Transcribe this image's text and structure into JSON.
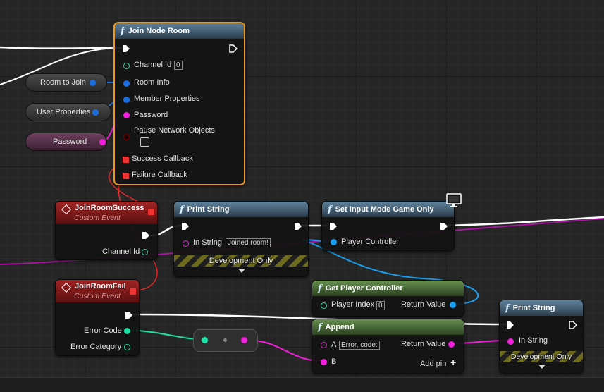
{
  "colors": {
    "exec": "#ffffff",
    "int_pin": "#1ee3a8",
    "struct_pin": "#1c6fe0",
    "object_pin": "#18a0ee",
    "string_pin": "#f21fdc",
    "delegate_pin": "#f03434",
    "selection": "#e89a1c"
  },
  "nodes": {
    "join_node_room": {
      "title": "Join Node Room",
      "channel_id_label": "Channel Id",
      "channel_id_value": "0",
      "room_info_label": "Room Info",
      "member_properties_label": "Member Properties",
      "password_label": "Password",
      "pause_network_objects_label": "Pause Network Objects",
      "success_callback_label": "Success Callback",
      "failure_callback_label": "Failure Callback"
    },
    "join_room_success": {
      "title": "JoinRoomSuccess",
      "subtitle": "Custom Event",
      "channel_id_label": "Channel Id"
    },
    "join_room_fail": {
      "title": "JoinRoomFail",
      "subtitle": "Custom Event",
      "error_code_label": "Error Code",
      "error_category_label": "Error Category"
    },
    "print_string_1": {
      "title": "Print String",
      "in_string_label": "In String",
      "in_string_value": "Joined room!",
      "dev_label": "Development Only"
    },
    "set_input_mode": {
      "title": "Set Input Mode Game Only",
      "player_controller_label": "Player Controller"
    },
    "get_player_controller": {
      "title": "Get Player Controller",
      "player_index_label": "Player Index",
      "player_index_value": "0",
      "return_value_label": "Return Value"
    },
    "append": {
      "title": "Append",
      "a_label": "A",
      "a_value": "Error, code:",
      "b_label": "B",
      "return_value_label": "Return Value",
      "add_pin_label": "Add pin"
    },
    "print_string_2": {
      "title": "Print String",
      "in_string_label": "In String",
      "dev_label": "Development Only"
    }
  },
  "variables": {
    "room_to_join": "Room to Join",
    "user_properties": "User Properties",
    "password": "Password"
  },
  "icons": {
    "function": "f",
    "add": "+",
    "expand": "chevron-down",
    "client_only": "monitor"
  }
}
